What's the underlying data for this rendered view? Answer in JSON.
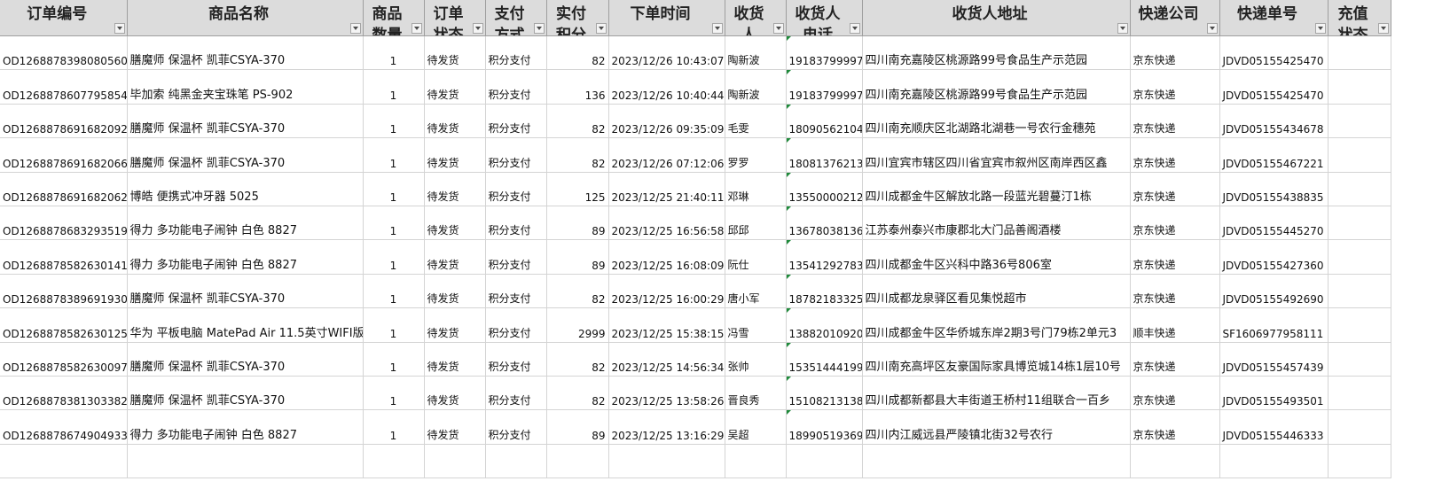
{
  "columns": [
    {
      "key": "order_no",
      "label": "订单编号"
    },
    {
      "key": "product",
      "label": "商品名称"
    },
    {
      "key": "qty",
      "label": "商品数量"
    },
    {
      "key": "status",
      "label": "订单状态"
    },
    {
      "key": "payment",
      "label": "支付方式"
    },
    {
      "key": "points",
      "label": "实付积分"
    },
    {
      "key": "time",
      "label": "下单时间"
    },
    {
      "key": "receiver",
      "label": "收货人"
    },
    {
      "key": "phone",
      "label": "收货人电话"
    },
    {
      "key": "address",
      "label": "收货人地址"
    },
    {
      "key": "courier",
      "label": "快递公司"
    },
    {
      "key": "tracking",
      "label": "快递单号"
    },
    {
      "key": "recharge",
      "label": "充值状态"
    }
  ],
  "rows": [
    {
      "order_no": "OD1268878398080560",
      "product": "膳魔师 保温杯 凯菲CSYA-370",
      "qty": "1",
      "status": "待发货",
      "payment": "积分支付",
      "points": "82",
      "time": "2023/12/26 10:43:07",
      "receiver": "陶新波",
      "phone": "19183799997",
      "address": "四川南充嘉陵区桃源路99号食品生产示范园",
      "courier": "京东快递",
      "tracking": "JDVD05155425470",
      "recharge": ""
    },
    {
      "order_no": "OD1268878607795854",
      "product": "毕加索 纯黑金夹宝珠笔 PS-902",
      "qty": "1",
      "status": "待发货",
      "payment": "积分支付",
      "points": "136",
      "time": "2023/12/26 10:40:44",
      "receiver": "陶新波",
      "phone": "19183799997",
      "address": "四川南充嘉陵区桃源路99号食品生产示范园",
      "courier": "京东快递",
      "tracking": "JDVD05155425470",
      "recharge": ""
    },
    {
      "order_no": "OD1268878691682092",
      "product": "膳魔师 保温杯 凯菲CSYA-370",
      "qty": "1",
      "status": "待发货",
      "payment": "积分支付",
      "points": "82",
      "time": "2023/12/26 09:35:09",
      "receiver": "毛雯",
      "phone": "18090562104",
      "address": "四川南充顺庆区北湖路北湖巷一号农行金穗苑",
      "courier": "京东快递",
      "tracking": "JDVD05155434678",
      "recharge": ""
    },
    {
      "order_no": "OD1268878691682066",
      "product": "膳魔师 保温杯 凯菲CSYA-370",
      "qty": "1",
      "status": "待发货",
      "payment": "积分支付",
      "points": "82",
      "time": "2023/12/26 07:12:06",
      "receiver": "罗罗",
      "phone": "18081376213",
      "address": "四川宜宾市辖区四川省宜宾市叙州区南岸西区鑫",
      "courier": "京东快递",
      "tracking": "JDVD05155467221",
      "recharge": ""
    },
    {
      "order_no": "OD1268878691682062",
      "product": "博皓 便携式冲牙器 5025",
      "qty": "1",
      "status": "待发货",
      "payment": "积分支付",
      "points": "125",
      "time": "2023/12/25 21:40:11",
      "receiver": "邓琳",
      "phone": "13550000212",
      "address": "四川成都金牛区解放北路一段蓝光碧蔓汀1栋",
      "courier": "京东快递",
      "tracking": "JDVD05155438835",
      "recharge": ""
    },
    {
      "order_no": "OD1268878683293519",
      "product": "得力 多功能电子闹钟 白色 8827",
      "qty": "1",
      "status": "待发货",
      "payment": "积分支付",
      "points": "89",
      "time": "2023/12/25 16:56:58",
      "receiver": "邱邱",
      "phone": "13678038136",
      "address": "江苏泰州泰兴市康郡北大门品善阁酒楼",
      "courier": "京东快递",
      "tracking": "JDVD05155445270",
      "recharge": ""
    },
    {
      "order_no": "OD1268878582630141",
      "product": "得力 多功能电子闹钟 白色 8827",
      "qty": "1",
      "status": "待发货",
      "payment": "积分支付",
      "points": "89",
      "time": "2023/12/25 16:08:09",
      "receiver": "阮仕",
      "phone": "13541292783",
      "address": "四川成都金牛区兴科中路36号806室",
      "courier": "京东快递",
      "tracking": "JDVD05155427360",
      "recharge": ""
    },
    {
      "order_no": "OD1268878389691930",
      "product": "膳魔师 保温杯 凯菲CSYA-370",
      "qty": "1",
      "status": "待发货",
      "payment": "积分支付",
      "points": "82",
      "time": "2023/12/25 16:00:29",
      "receiver": "唐小军",
      "phone": "18782183325",
      "address": "四川成都龙泉驿区看见集悦超市",
      "courier": "京东快递",
      "tracking": "JDVD05155492690",
      "recharge": ""
    },
    {
      "order_no": "OD1268878582630125",
      "product": "华为 平板电脑 MatePad Air 11.5英寸WIFI版",
      "qty": "1",
      "status": "待发货",
      "payment": "积分支付",
      "points": "2999",
      "time": "2023/12/25 15:38:15",
      "receiver": "冯雪",
      "phone": "13882010920",
      "address": "四川成都金牛区华侨城东岸2期3号门79栋2单元3",
      "courier": "顺丰快递",
      "tracking": "SF1606977958111",
      "recharge": ""
    },
    {
      "order_no": "OD1268878582630097",
      "product": "膳魔师 保温杯 凯菲CSYA-370",
      "qty": "1",
      "status": "待发货",
      "payment": "积分支付",
      "points": "82",
      "time": "2023/12/25 14:56:34",
      "receiver": "张帅",
      "phone": "15351444199",
      "address": "四川南充高坪区友豪国际家具博览城14栋1层10号",
      "courier": "京东快递",
      "tracking": "JDVD05155457439",
      "recharge": ""
    },
    {
      "order_no": "OD1268878381303382",
      "product": "膳魔师 保温杯 凯菲CSYA-370",
      "qty": "1",
      "status": "待发货",
      "payment": "积分支付",
      "points": "82",
      "time": "2023/12/25 13:58:26",
      "receiver": "晋良秀",
      "phone": "15108213138",
      "address": "四川成都新都县大丰街道王桥村11组联合一百乡",
      "courier": "京东快递",
      "tracking": "JDVD05155493501",
      "recharge": ""
    },
    {
      "order_no": "OD1268878674904933",
      "product": "得力 多功能电子闹钟 白色 8827",
      "qty": "1",
      "status": "待发货",
      "payment": "积分支付",
      "points": "89",
      "time": "2023/12/25 13:16:29",
      "receiver": "吴超",
      "phone": "18990519369",
      "address": "四川内江威远县严陵镇北街32号农行",
      "courier": "京东快递",
      "tracking": "JDVD05155446333",
      "recharge": ""
    }
  ]
}
